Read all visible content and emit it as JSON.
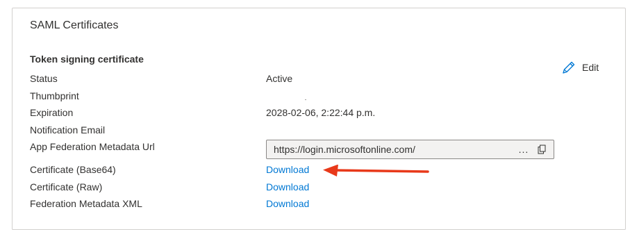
{
  "card": {
    "title": "SAML Certificates"
  },
  "section": {
    "title": "Token signing certificate",
    "edit_label": "Edit"
  },
  "rows": {
    "status": {
      "label": "Status",
      "value": "Active"
    },
    "thumbprint": {
      "label": "Thumbprint"
    },
    "expiration": {
      "label": "Expiration",
      "value": "2028-02-06, 2:22:44 p.m."
    },
    "notification_email": {
      "label": "Notification Email"
    },
    "metadata_url": {
      "label": "App Federation Metadata Url",
      "value": "https://login.microsoftonline.com/",
      "more": "..."
    },
    "cert_base64": {
      "label": "Certificate (Base64)",
      "link": "Download"
    },
    "cert_raw": {
      "label": "Certificate (Raw)",
      "link": "Download"
    },
    "federation_xml": {
      "label": "Federation Metadata XML",
      "link": "Download"
    }
  },
  "icons": {
    "edit": "pencil-icon",
    "copy": "copy-icon",
    "annotation": "red-arrow"
  },
  "colors": {
    "link": "#0078d4",
    "text": "#323130",
    "annotation_arrow": "#e8391a",
    "field_bg": "#f3f2f1",
    "border": "#d2d0ce"
  }
}
